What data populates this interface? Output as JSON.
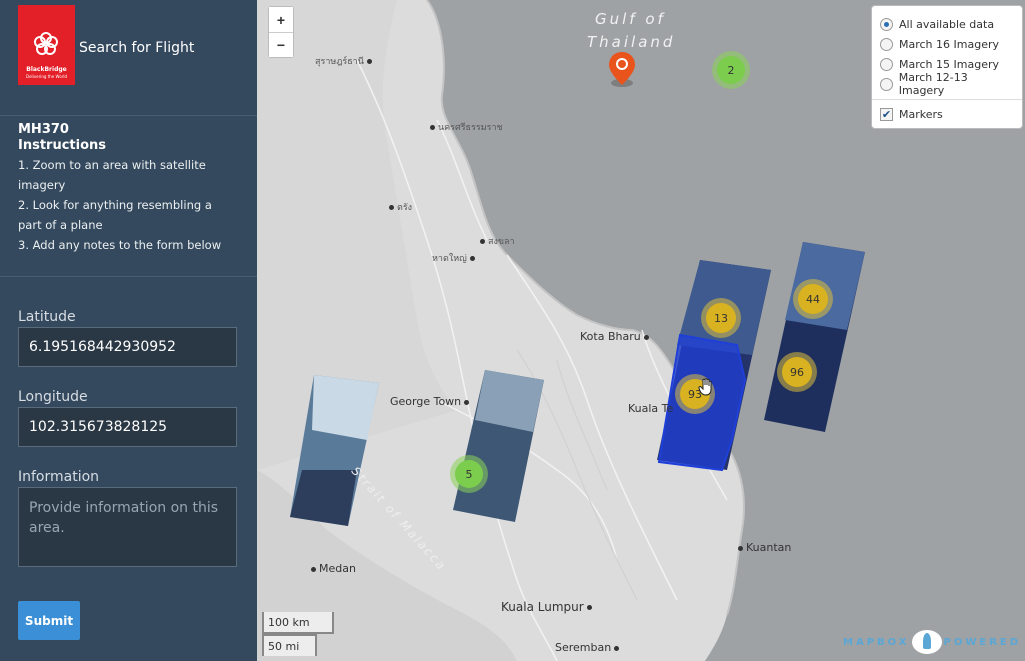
{
  "sidebar": {
    "logo_name": "BlackBridge",
    "logo_tagline": "Delivering the World",
    "app_title": "Search for Flight",
    "mh_title": "MH370",
    "instructions_title": "Instructions",
    "instructions": [
      "1. Zoom to an area with satellite imagery",
      "2. Look for anything resembling a part of a plane",
      "3. Add any notes to the form below"
    ],
    "latitude_label": "Latitude",
    "latitude_value": "6.195168442930952",
    "longitude_label": "Longitude",
    "longitude_value": "102.315673828125",
    "information_label": "Information",
    "information_placeholder": "Provide information on this area.",
    "submit_label": "Submit"
  },
  "map": {
    "zoom_in": "+",
    "zoom_out": "−",
    "labels": {
      "gulf": [
        "Gulf of",
        "Thailand"
      ],
      "strait": "Strait of Malacca",
      "thai_city_1": "สุราษฎร์ธานี",
      "thai_city_2": "นครศรีธรรมราช",
      "thai_city_3": "ตรัง",
      "thai_city_4": "สงขลา",
      "thai_city_5": "หาดใหญ่",
      "kota_bharu": "Kota Bharu",
      "george_town": "George Town",
      "kuala_te": "Kuala Te",
      "kuantan": "Kuantan",
      "medan": "Medan",
      "kuala_lumpur": "Kuala Lumpur",
      "seremban": "Seremban"
    },
    "clusters": [
      {
        "count": "2",
        "color": "green"
      },
      {
        "count": "5",
        "color": "green"
      },
      {
        "count": "13",
        "color": "yellow"
      },
      {
        "count": "93",
        "color": "yellow"
      },
      {
        "count": "44",
        "color": "yellow"
      },
      {
        "count": "96",
        "color": "yellow"
      }
    ],
    "layers": {
      "options": [
        "All available data",
        "March 16 Imagery",
        "March 15 Imagery",
        "March 12-13 Imagery"
      ],
      "selected": "All available data",
      "markers_label": "Markers",
      "markers_checked": true
    },
    "scale": {
      "km": "100 km",
      "mi": "50 mi"
    },
    "attribution": {
      "left": "MAPBOX",
      "right": "POWERED"
    },
    "colors": {
      "sidebar": "#34495e",
      "submit": "#3a8fd6",
      "marker": "#e8541c",
      "selection": "#1f3fd9",
      "logo": "#e32028"
    }
  }
}
